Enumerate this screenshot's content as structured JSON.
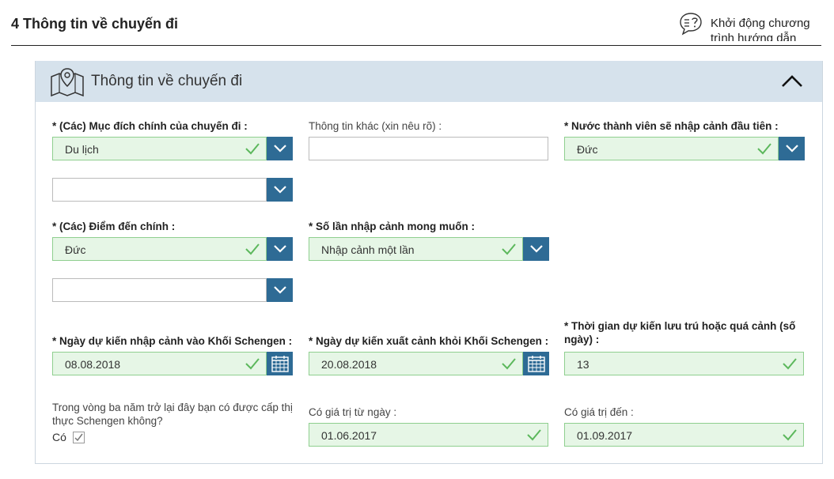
{
  "header": {
    "title": "4 Thông tin về chuyến đi",
    "help_label": "Khởi động chương trình hướng dẫn"
  },
  "section": {
    "title": "Thông tin về chuyến đi"
  },
  "fields": {
    "purpose": {
      "label": "* (Các) Mục đích chính của chuyến đi :",
      "value": "Du lịch"
    },
    "purpose_extra": {
      "value": ""
    },
    "other_info": {
      "label": "Thông tin khác (xin nêu rõ) :",
      "value": ""
    },
    "first_entry_country": {
      "label": "* Nước thành viên sẽ nhập cảnh đầu tiên :",
      "value": "Đức"
    },
    "destination": {
      "label": "* (Các) Điểm đến chính :",
      "value": "Đức"
    },
    "destination_extra": {
      "value": ""
    },
    "entries": {
      "label": "* Số lần nhập cảnh mong muốn :",
      "value": "Nhập cảnh một lần"
    },
    "arrival_date": {
      "label": "* Ngày dự kiến nhập cảnh vào Khối Schengen :",
      "value": "08.08.2018"
    },
    "departure_date": {
      "label": "* Ngày dự kiến xuất cảnh khỏi Khối Schengen :",
      "value": "20.08.2018"
    },
    "duration": {
      "label": "* Thời gian dự kiến lưu trú hoặc quá cảnh (số ngày) :",
      "value": "13"
    },
    "previous_visa": {
      "label": "Trong vòng ba năm trở lại đây bạn có được cấp thị thực Schengen không?",
      "option": "Có"
    },
    "valid_from": {
      "label": "Có giá trị từ ngày :",
      "value": "01.06.2017"
    },
    "valid_to": {
      "label": "Có giá trị đến :",
      "value": "01.09.2017"
    }
  },
  "colors": {
    "accent": "#2e6b95",
    "valid_bg": "#e6f6e6",
    "header_bg": "#d6e2ec",
    "check": "#5cb85c"
  }
}
